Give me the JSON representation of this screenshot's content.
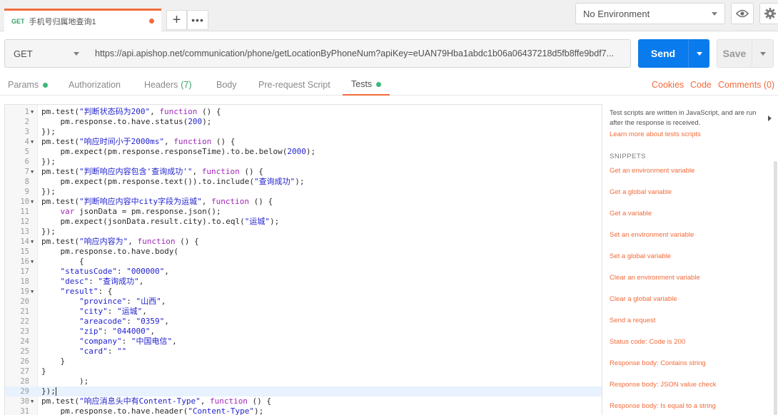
{
  "tab": {
    "method": "GET",
    "title": "手机号归属地查询1"
  },
  "tab_controls": {
    "new_tab": "+",
    "more": "•••"
  },
  "environment": {
    "selected": "No Environment"
  },
  "request": {
    "method": "GET",
    "url": "https://api.apishop.net/communication/phone/getLocationByPhoneNum?apiKey=eUAN79Hba1abdc1b06a06437218d5fb8ffe9bdf7...",
    "send_label": "Send",
    "save_label": "Save"
  },
  "request_tabs": {
    "params": "Params",
    "authorization": "Authorization",
    "headers": "Headers",
    "headers_count": "(7)",
    "body": "Body",
    "prerequest": "Pre-request Script",
    "tests": "Tests"
  },
  "right_links": {
    "cookies": "Cookies",
    "code": "Code",
    "comments": "Comments (0)"
  },
  "editor": {
    "lines": [
      "pm.test(\"判断状态码为200\", function () {",
      "    pm.response.to.have.status(200);",
      "});",
      "pm.test(\"响应时间小于2000ms\", function () {",
      "    pm.expect(pm.response.responseTime).to.be.below(2000);",
      "});",
      "pm.test(\"判断响应内容包含'查询成功'\", function () {",
      "    pm.expect(pm.response.text()).to.include(\"查询成功\");",
      "});",
      "pm.test(\"判断响应内容中city字段为运城\", function () {",
      "    var jsonData = pm.response.json();",
      "    pm.expect(jsonData.result.city).to.eql(\"运城\");",
      "});",
      "pm.test(\"响应内容为\", function () {",
      "    pm.response.to.have.body(",
      "        {",
      "    \"statusCode\": \"000000\",",
      "    \"desc\": \"查询成功\",",
      "    \"result\": {",
      "        \"province\": \"山西\",",
      "        \"city\": \"运城\",",
      "        \"areacode\": \"0359\",",
      "        \"zip\": \"044000\",",
      "        \"company\": \"中国电信\",",
      "        \"card\": \"\"",
      "    }",
      "}",
      "        );",
      "});",
      "pm.test(\"响应消息头中有Content-Type\", function () {",
      "    pm.response.to.have.header(\"Content-Type\");"
    ]
  },
  "panel": {
    "description": "Test scripts are written in JavaScript, and are run after the response is received.",
    "learn_more": "Learn more about tests scripts",
    "snippets_title": "SNIPPETS",
    "snippets": [
      "Get an environment variable",
      "Get a global variable",
      "Get a variable",
      "Set an environment variable",
      "Set a global variable",
      "Clear an environment variable",
      "Clear a global variable",
      "Send a request",
      "Status code: Code is 200",
      "Response body: Contains string",
      "Response body: JSON value check",
      "Response body: Is equal to a string"
    ]
  },
  "colors": {
    "accent": "#f26b3a",
    "send": "#097bed",
    "active_dot": "#3fb67a"
  }
}
